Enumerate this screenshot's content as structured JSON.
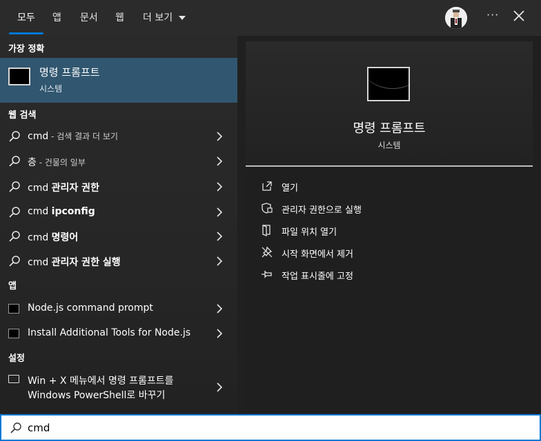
{
  "tabs": [
    {
      "label": "모두"
    },
    {
      "label": "앱"
    },
    {
      "label": "문서"
    },
    {
      "label": "웹"
    },
    {
      "label": "더 보기"
    }
  ],
  "more_menu_label": "···",
  "sections": {
    "best_match": "가장 정확",
    "web_search": "웹 검색",
    "apps": "앱",
    "settings": "설정"
  },
  "best_match": {
    "title": "명령 프롬프트",
    "subtitle": "시스템"
  },
  "web_results": [
    {
      "prefix": "cmd",
      "rest": " - 검색 결과 더 보기",
      "rest_style": "light"
    },
    {
      "prefix": "층",
      "rest": " - 건물의 일부",
      "rest_style": "light"
    },
    {
      "prefix": "cmd ",
      "rest": "관리자 권한",
      "rest_style": "bold"
    },
    {
      "prefix": "cmd ",
      "rest": "ipconfig",
      "rest_style": "bold"
    },
    {
      "prefix": "cmd ",
      "rest": "명령어",
      "rest_style": "bold"
    },
    {
      "prefix": "cmd ",
      "rest": "관리자 권한 실행",
      "rest_style": "bold"
    }
  ],
  "apps": [
    {
      "label": "Node.js command prompt"
    },
    {
      "label": "Install Additional Tools for Node.js"
    }
  ],
  "settings": {
    "line1": "Win + X 메뉴에서 명령 프롬프트를",
    "line2": "Windows PowerShell로 바꾸기"
  },
  "detail": {
    "title": "명령 프롬프트",
    "subtitle": "시스템",
    "actions": [
      {
        "label": "열기",
        "icon": "open-icon"
      },
      {
        "label": "관리자 권한으로 실행",
        "icon": "shield-icon"
      },
      {
        "label": "파일 위치 열기",
        "icon": "file-location-icon"
      },
      {
        "label": "시작 화면에서 제거",
        "icon": "unpin-icon"
      },
      {
        "label": "작업 표시줄에 고정",
        "icon": "pin-icon"
      }
    ]
  },
  "search": {
    "value": "cmd"
  },
  "colors": {
    "accent": "#0078d4",
    "selected_row": "#31566f"
  }
}
